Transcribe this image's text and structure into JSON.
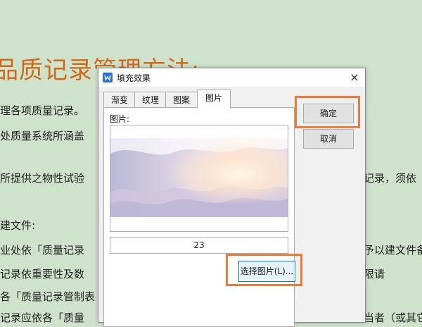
{
  "document": {
    "title": "品质记录管理方法:",
    "lines": [
      "理各项质量记录。",
      "处质量系统所涵盖",
      "所提供之物性试验",
      "建文件:",
      "业处依「质量记录",
      "记录依重要性及数",
      "各「质量记录管制表",
      "记录应依各「质量"
    ],
    "right_lines": [
      "记录，须依",
      "予以建文件备",
      "限请",
      "当者（或其它"
    ]
  },
  "dialog": {
    "title": "填充效果",
    "close": "×",
    "tabs": [
      "渐变",
      "纹理",
      "图案",
      "图片"
    ],
    "active_tab": "图片",
    "picture_label": "图片:",
    "picture_name": "23",
    "select_button": "选择图片(L)...",
    "ok_button": "确定",
    "cancel_button": "取消"
  },
  "colors": {
    "background": "#cfe3cc",
    "title_orange": "#d06a1a",
    "highlight": "#f07a3c",
    "accent_blue": "#0078d7"
  },
  "icons": {
    "app": "wps-writer-icon",
    "close": "close-icon"
  }
}
